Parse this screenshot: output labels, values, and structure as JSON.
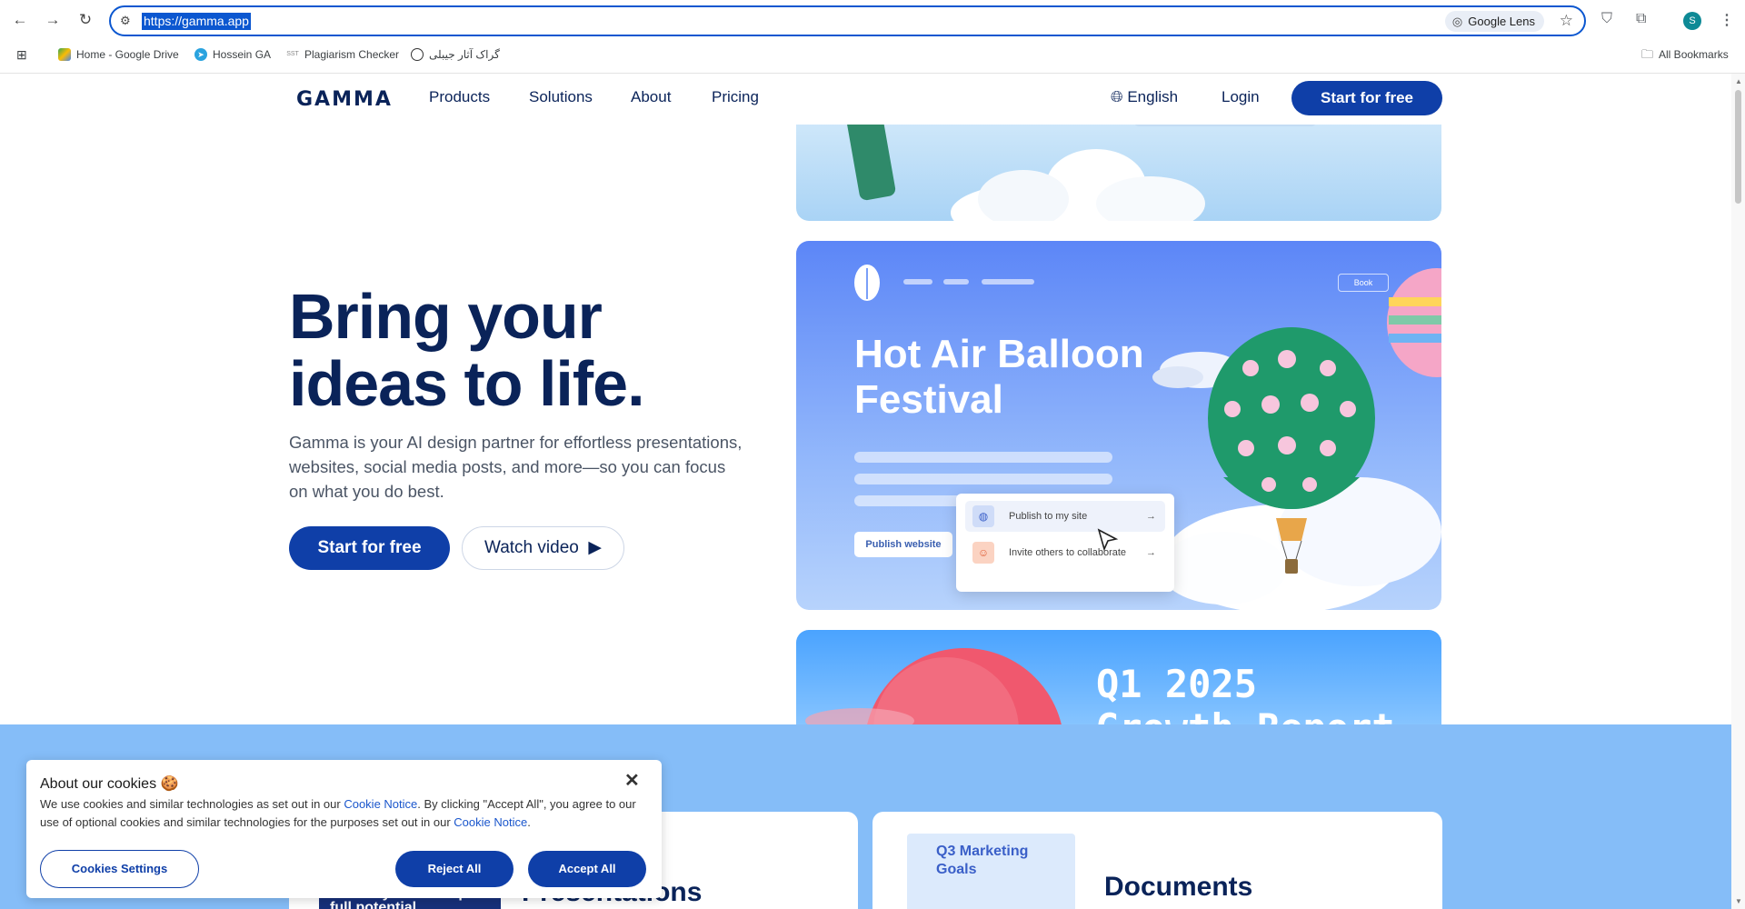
{
  "browser": {
    "url": "https://gamma.app",
    "lens_label": "Google Lens",
    "avatar_letter": "S",
    "bookmarks": [
      {
        "label": "Home - Google Drive",
        "icon": "google-drive-icon"
      },
      {
        "label": "Hossein GA",
        "icon": "telegram-icon"
      },
      {
        "label": "Plagiarism Checker",
        "icon": "sst-icon"
      },
      {
        "label": "گراک آثار جیبلی",
        "icon": "openai-icon"
      }
    ],
    "all_bookmarks_label": "All Bookmarks"
  },
  "site": {
    "logo": "GAMMA",
    "nav": {
      "products": "Products",
      "solutions": "Solutions",
      "about": "About",
      "pricing": "Pricing",
      "language": "English",
      "login": "Login",
      "cta": "Start for free"
    },
    "hero": {
      "title_line1": "Bring your",
      "title_line2": "ideas to life.",
      "subtitle": "Gamma is your AI design partner for effortless presentations, websites, social media posts, and more—so you can focus on what you do best.",
      "start_label": "Start for free",
      "watch_label": "Watch video"
    },
    "cards": {
      "balloon_title_line1": "Hot Air Balloon",
      "balloon_title_line2": "Festival",
      "book_label": "Book",
      "publish_website": "Publish website",
      "publish_to_site": "Publish to my site",
      "invite_others": "Invite others to collaborate",
      "report_title_line1": "Q1 2025",
      "report_title_line2": "Growth Report"
    },
    "features": {
      "presentations_thumb": "Unlock your startup's full potential",
      "presentations_label": "Presentations",
      "documents_thumb_line1": "Q3 Marketing",
      "documents_thumb_line2": "Goals",
      "documents_label": "Documents"
    }
  },
  "cookie_banner": {
    "title": "About our cookies 🍪",
    "text_part1": "We use cookies and similar technologies as set out in our ",
    "link1": "Cookie Notice",
    "text_part2": ". By clicking \"Accept All\", you agree to our use of optional cookies and similar technologies for the purposes set out in our ",
    "link2": "Cookie Notice",
    "text_part3": ".",
    "settings_label": "Cookies Settings",
    "reject_label": "Reject All",
    "accept_label": "Accept All"
  }
}
